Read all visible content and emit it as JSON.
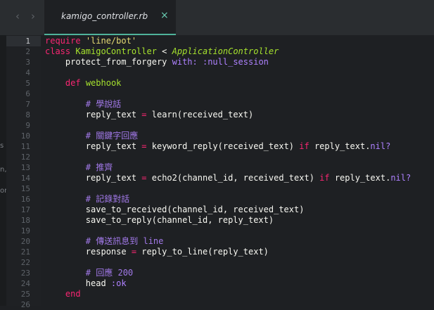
{
  "tab": {
    "filename": "kamigo_controller.rb",
    "close_glyph": "×"
  },
  "nav": {
    "back": "‹",
    "forward": "›"
  },
  "sidebar_fragments": [
    "s",
    "n,",
    "or"
  ],
  "lines": [
    {
      "n": "1",
      "seg": [
        [
          "kw",
          "require"
        ],
        [
          "txt",
          " "
        ],
        [
          "str",
          "'line/bot'"
        ]
      ]
    },
    {
      "n": "2",
      "seg": [
        [
          "kw",
          "class"
        ],
        [
          "txt",
          " "
        ],
        [
          "cls",
          "KamigoController"
        ],
        [
          "txt",
          " < "
        ],
        [
          "cls-i",
          "ApplicationController"
        ]
      ]
    },
    {
      "n": "3",
      "seg": [
        [
          "txt",
          "    protect_from_forgery "
        ],
        [
          "sym",
          "with:"
        ],
        [
          "txt",
          " "
        ],
        [
          "sym",
          ":null_session"
        ]
      ]
    },
    {
      "n": "4",
      "seg": []
    },
    {
      "n": "5",
      "seg": [
        [
          "txt",
          "    "
        ],
        [
          "kw",
          "def"
        ],
        [
          "txt",
          " "
        ],
        [
          "fn",
          "webhook"
        ]
      ]
    },
    {
      "n": "6",
      "seg": []
    },
    {
      "n": "7",
      "seg": [
        [
          "txt",
          "        "
        ],
        [
          "cm",
          "# 學說話"
        ]
      ]
    },
    {
      "n": "8",
      "seg": [
        [
          "txt",
          "        reply_text "
        ],
        [
          "kw",
          "="
        ],
        [
          "txt",
          " learn(received_text)"
        ]
      ]
    },
    {
      "n": "9",
      "seg": []
    },
    {
      "n": "10",
      "seg": [
        [
          "txt",
          "        "
        ],
        [
          "cm",
          "# 關鍵字回應"
        ]
      ]
    },
    {
      "n": "11",
      "seg": [
        [
          "txt",
          "        reply_text "
        ],
        [
          "kw",
          "="
        ],
        [
          "txt",
          " keyword_reply(received_text) "
        ],
        [
          "kw",
          "if"
        ],
        [
          "txt",
          " reply_text."
        ],
        [
          "sym",
          "nil?"
        ]
      ]
    },
    {
      "n": "12",
      "seg": []
    },
    {
      "n": "13",
      "seg": [
        [
          "txt",
          "        "
        ],
        [
          "cm",
          "# 推齊"
        ]
      ]
    },
    {
      "n": "14",
      "seg": [
        [
          "txt",
          "        reply_text "
        ],
        [
          "kw",
          "="
        ],
        [
          "txt",
          " echo2(channel_id, received_text) "
        ],
        [
          "kw",
          "if"
        ],
        [
          "txt",
          " reply_text."
        ],
        [
          "sym",
          "nil?"
        ]
      ]
    },
    {
      "n": "15",
      "seg": []
    },
    {
      "n": "16",
      "seg": [
        [
          "txt",
          "        "
        ],
        [
          "cm",
          "# 記錄對話"
        ]
      ]
    },
    {
      "n": "17",
      "seg": [
        [
          "txt",
          "        save_to_received(channel_id, received_text)"
        ]
      ]
    },
    {
      "n": "18",
      "seg": [
        [
          "txt",
          "        save_to_reply(channel_id, reply_text)"
        ]
      ]
    },
    {
      "n": "19",
      "seg": []
    },
    {
      "n": "20",
      "seg": [
        [
          "txt",
          "        "
        ],
        [
          "cm",
          "# 傳送訊息到 line"
        ]
      ]
    },
    {
      "n": "21",
      "seg": [
        [
          "txt",
          "        response "
        ],
        [
          "kw",
          "="
        ],
        [
          "txt",
          " reply_to_line(reply_text)"
        ]
      ]
    },
    {
      "n": "22",
      "seg": []
    },
    {
      "n": "23",
      "seg": [
        [
          "txt",
          "        "
        ],
        [
          "cm",
          "# 回應 200"
        ]
      ]
    },
    {
      "n": "24",
      "seg": [
        [
          "txt",
          "        head "
        ],
        [
          "sym",
          ":ok"
        ]
      ]
    },
    {
      "n": "25",
      "seg": [
        [
          "txt",
          "    "
        ],
        [
          "kw",
          "end"
        ]
      ]
    },
    {
      "n": "26",
      "seg": []
    }
  ]
}
